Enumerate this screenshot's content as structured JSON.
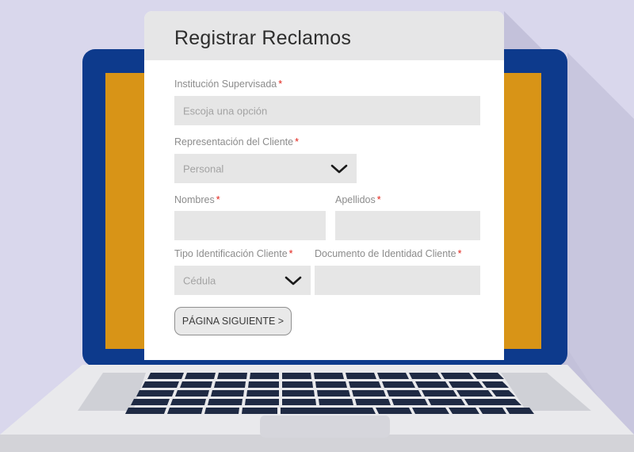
{
  "form": {
    "title": "Registrar Reclamos",
    "required_mark": "*",
    "institucion": {
      "label": "Institución Supervisada",
      "placeholder": "Escoja una opción"
    },
    "representacion": {
      "label": "Representación del Cliente",
      "value": "Personal"
    },
    "nombres": {
      "label": "Nombres",
      "value": ""
    },
    "apellidos": {
      "label": "Apellidos",
      "value": ""
    },
    "tipo_identificacion": {
      "label": "Tipo Identificación Cliente",
      "value": "Cédula"
    },
    "documento_identidad": {
      "label": "Documento de Identidad Cliente",
      "value": ""
    },
    "next_button": "PÁGINA SIGUIENTE >"
  },
  "colors": {
    "background": "#d9d7ec",
    "laptop_bezel": "#0d3a8c",
    "screen_wallpaper": "#d89417",
    "form_header": "#e6e6e7",
    "field_fill": "#e6e6e6",
    "required_asterisk": "#e2231a"
  },
  "icons": {
    "dropdown": "chevron-down-icon"
  }
}
